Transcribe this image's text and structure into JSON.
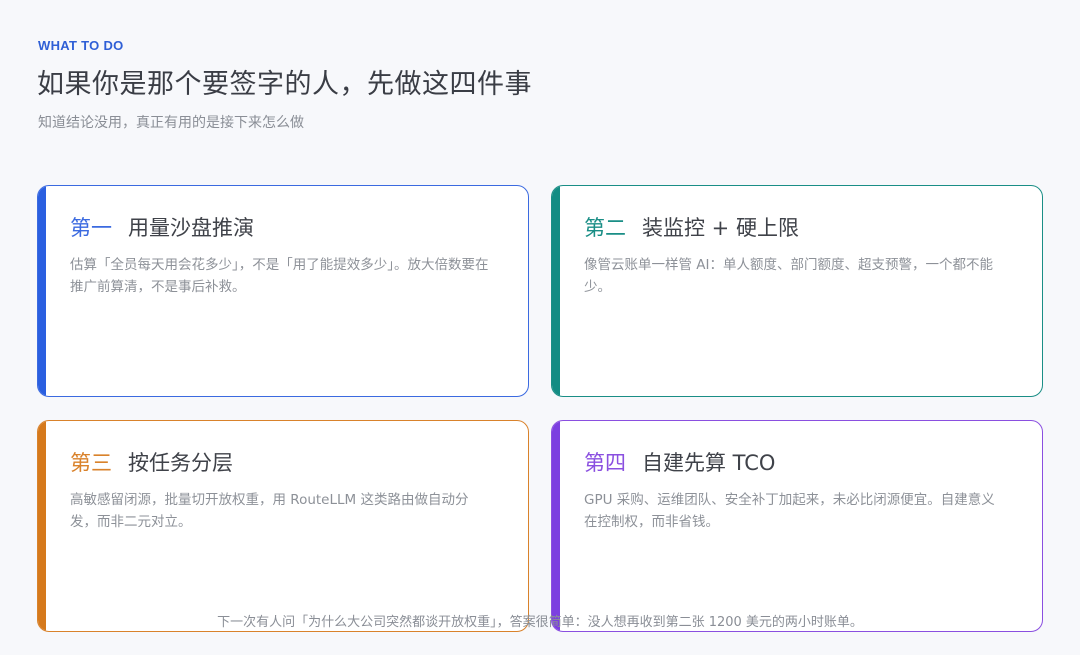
{
  "header": {
    "eyebrow": "WHAT TO DO",
    "title": "如果你是那个要签字的人，先做这四件事",
    "subtitle": "知道结论没用，真正有用的是接下来怎么做"
  },
  "cards": [
    {
      "num": "第一",
      "title": "用量沙盘推演",
      "desc": "估算「全员每天用会花多少」，不是「用了能提效多少」。放大倍数要在推广前算清，不是事后补救。",
      "accent": "#2a5fe0"
    },
    {
      "num": "第二",
      "title": "装监控 + 硬上限",
      "desc": "像管云账单一样管 AI：单人额度、部门额度、超支预警，一个都不能少。",
      "accent": "#138c83"
    },
    {
      "num": "第三",
      "title": "按任务分层",
      "desc": "高敏感留闭源，批量切开放权重，用 RouteLLM 这类路由做自动分发，而非二元对立。",
      "accent": "#d5791c"
    },
    {
      "num": "第四",
      "title": "自建先算 TCO",
      "desc": "GPU 采购、运维团队、安全补丁加起来，未必比闭源便宜。自建意义在控制权，而非省钱。",
      "accent": "#7c3fe0"
    }
  ],
  "footer": {
    "text": "下一次有人问「为什么大公司突然都谈开放权重」，答案很简单：没人想再收到第二张 1200 美元的两小时账单。"
  }
}
